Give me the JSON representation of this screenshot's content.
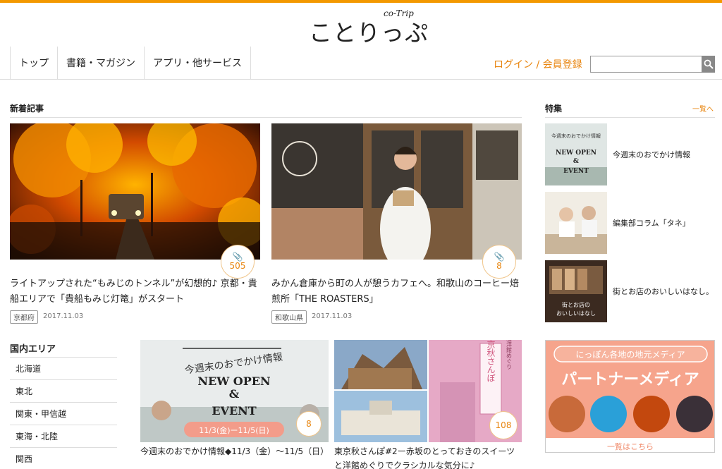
{
  "brand": {
    "logo_main": "ことりっぷ",
    "logo_sub": "co-Trip",
    "accent": "#f39800"
  },
  "nav": {
    "items": [
      {
        "label": "トップ"
      },
      {
        "label": "書籍・マガジン"
      },
      {
        "label": "アプリ・他サービス"
      }
    ],
    "login_label": "ログイン / 会員登録",
    "search_placeholder": "",
    "search_icon": "search-icon"
  },
  "news": {
    "title": "新着記事",
    "articles": [
      {
        "title": "ライトアップされた“もみじのトンネル”が幻想的♪ 京都・貴船エリアで「貴船もみじ灯篭」がスタート",
        "count": "505",
        "tag": "京都府",
        "date": "2017.11.03"
      },
      {
        "title": "みかん倉庫から町の人が憩うカフェへ。和歌山のコーヒー焙煎所「THE ROASTERS」",
        "count": "8",
        "tag": "和歌山県",
        "date": "2017.11.03"
      },
      {
        "title": "今週末のおでかけ情報◆11/3（金）～11/5（日）",
        "count": "8",
        "image_text": {
          "line1": "今週末のおでかけ情報",
          "line2": "NEW OPEN",
          "line3": "&",
          "line4": "EVENT",
          "dates": "11/3(金)ー11/5(日)"
        }
      },
      {
        "title": "東京秋さんぽ#2ー赤坂のとっておきのスイーツと洋館めぐりでクラシカルな気分に♪",
        "count": "108",
        "image_text": {
          "title": "東京秋さんぽ",
          "sub": "赤坂洋館めぐり"
        }
      }
    ]
  },
  "features": {
    "title": "特集",
    "more_label": "一覧へ",
    "items": [
      {
        "label": "今週末のおでかけ情報",
        "thumb_text": [
          "今週末のおでかけ情報",
          "NEW OPEN",
          "&",
          "EVENT"
        ]
      },
      {
        "label": "編集部コラム「タネ」"
      },
      {
        "label": "街とお店のおいしいはなし。",
        "thumb_text": [
          "街とお店の",
          "おいしいはなし"
        ]
      }
    ]
  },
  "areas": {
    "title": "国内エリア",
    "items": [
      "北海道",
      "東北",
      "関東・甲信越",
      "東海・北陸",
      "関西"
    ]
  },
  "partner": {
    "top_text": "にっぽん各地の地元メディア",
    "main_text": "パートナーメディア",
    "bottom_text": "一覧はこちら"
  }
}
